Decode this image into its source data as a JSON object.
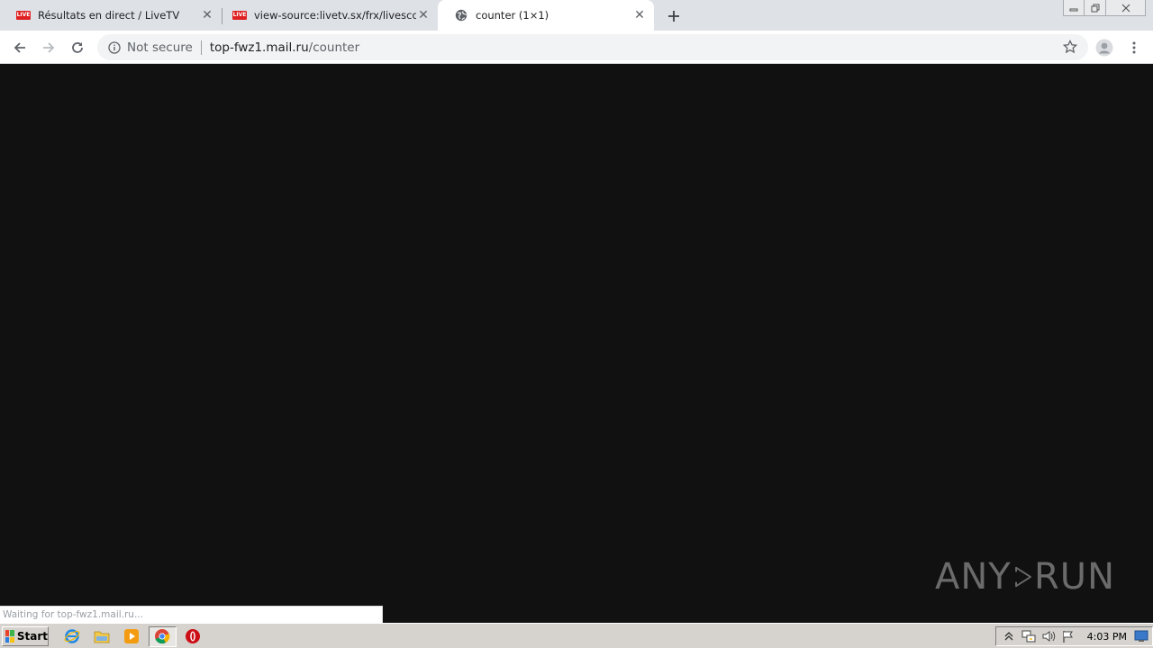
{
  "tabs": [
    {
      "title": "Résultats en direct / LiveTV",
      "favicon": "live-badge-icon",
      "badge": "LIVE"
    },
    {
      "title": "view-source:livetv.sx/frx/livescore/",
      "favicon": "live-badge-icon",
      "badge": "LIVE"
    },
    {
      "title": "counter (1×1)",
      "favicon": "globe-icon",
      "active": true
    }
  ],
  "omnibox": {
    "security_label": "Not secure",
    "host": "top-fwz1.mail.ru",
    "path": "/counter"
  },
  "status_text": "Waiting for top-fwz1.mail.ru...",
  "watermark": {
    "left": "ANY",
    "right": "RUN"
  },
  "taskbar": {
    "start_label": "Start",
    "clock": "4:03 PM"
  },
  "colors": {
    "content_bg": "#111111",
    "tabstrip_bg": "#dee1e6",
    "live_badge": "#e02020"
  }
}
